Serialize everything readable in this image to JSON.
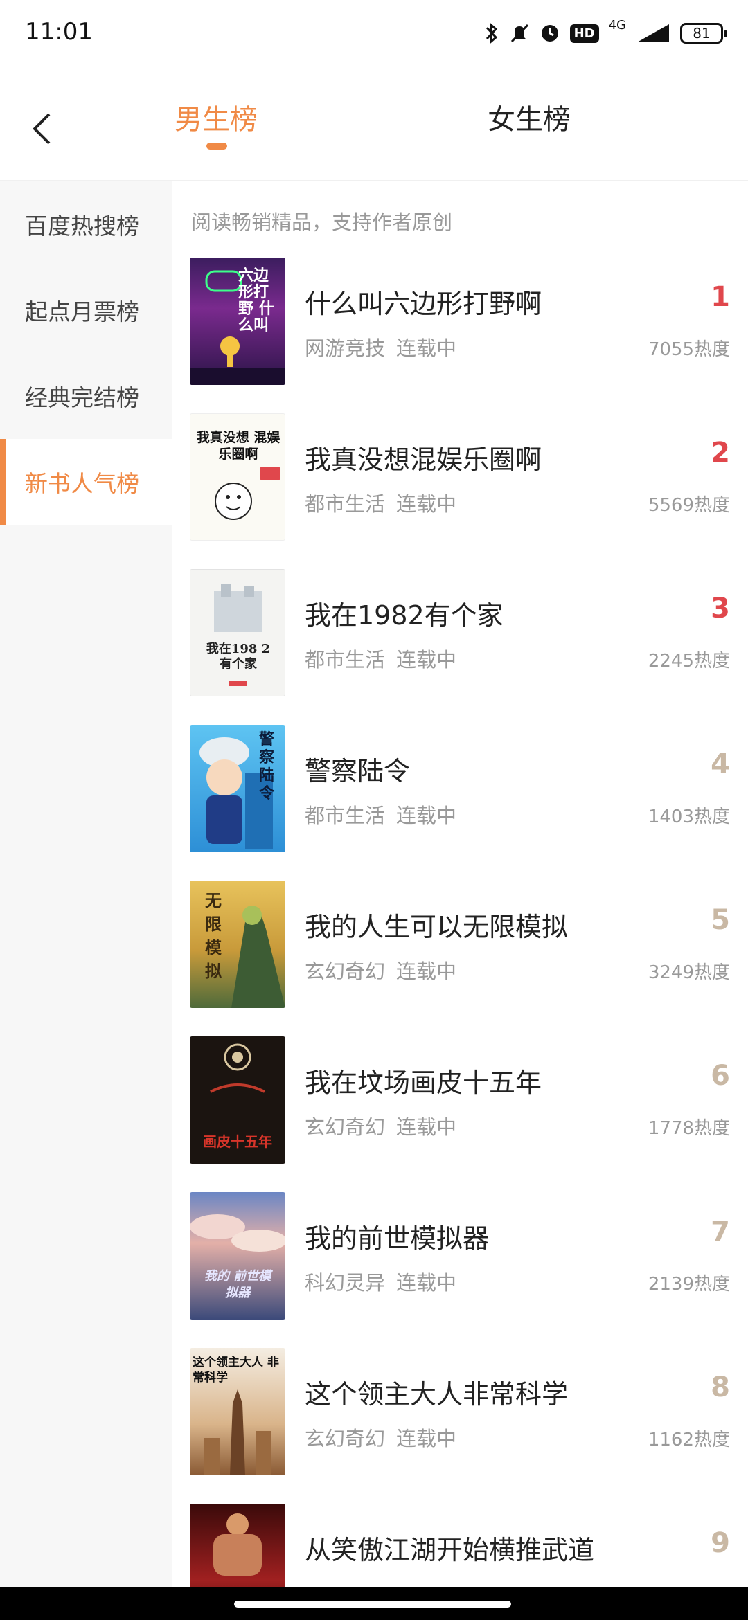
{
  "status_bar": {
    "time": "11:01",
    "network": "4G",
    "hd": "HD",
    "battery": "81",
    "icons": [
      "bluetooth-icon",
      "mute-icon",
      "alarm-icon",
      "hd-icon",
      "signal-icon",
      "battery-icon"
    ]
  },
  "header": {
    "back_icon": "back-arrow-icon",
    "tabs": [
      {
        "label": "男生榜",
        "active": true
      },
      {
        "label": "女生榜",
        "active": false
      }
    ]
  },
  "sidebar": {
    "items": [
      {
        "label": "百度热搜榜",
        "active": false
      },
      {
        "label": "起点月票榜",
        "active": false
      },
      {
        "label": "经典完结榜",
        "active": false
      },
      {
        "label": "新书人气榜",
        "active": true
      }
    ]
  },
  "main": {
    "subtitle": "阅读畅销精品，支持作者原创",
    "books": [
      {
        "rank": "1",
        "title": "什么叫六边形打野啊",
        "genre": "网游竞技",
        "status": "连载中",
        "heat": "7055热度",
        "cover_text": "六边形打野 什么叫"
      },
      {
        "rank": "2",
        "title": "我真没想混娱乐圈啊",
        "genre": "都市生活",
        "status": "连载中",
        "heat": "5569热度",
        "cover_text": "我真没想 混娱乐圈啊"
      },
      {
        "rank": "3",
        "title": "我在1982有个家",
        "genre": "都市生活",
        "status": "连载中",
        "heat": "2245热度",
        "cover_text": "我在198 2有个家"
      },
      {
        "rank": "4",
        "title": "警察陆令",
        "genre": "都市生活",
        "status": "连载中",
        "heat": "1403热度",
        "cover_text": "警察陆令"
      },
      {
        "rank": "5",
        "title": "我的人生可以无限模拟",
        "genre": "玄幻奇幻",
        "status": "连载中",
        "heat": "3249热度",
        "cover_text": "无限模拟"
      },
      {
        "rank": "6",
        "title": "我在坟场画皮十五年",
        "genre": "玄幻奇幻",
        "status": "连载中",
        "heat": "1778热度",
        "cover_text": "画皮十五年"
      },
      {
        "rank": "7",
        "title": "我的前世模拟器",
        "genre": "科幻灵异",
        "status": "连载中",
        "heat": "2139热度",
        "cover_text": "我的 前世模拟器"
      },
      {
        "rank": "8",
        "title": "这个领主大人非常科学",
        "genre": "玄幻奇幻",
        "status": "连载中",
        "heat": "1162热度",
        "cover_text": "这个领主大人 非常科学"
      },
      {
        "rank": "9",
        "title": "从笑傲江湖开始横推武道",
        "genre": "",
        "status": "",
        "heat": "",
        "cover_text": ""
      }
    ]
  },
  "colors": {
    "accent": "#f08a46",
    "rank_top3": "#e0474c",
    "rank_other": "#c9b8a4",
    "meta_gray": "#999999"
  }
}
